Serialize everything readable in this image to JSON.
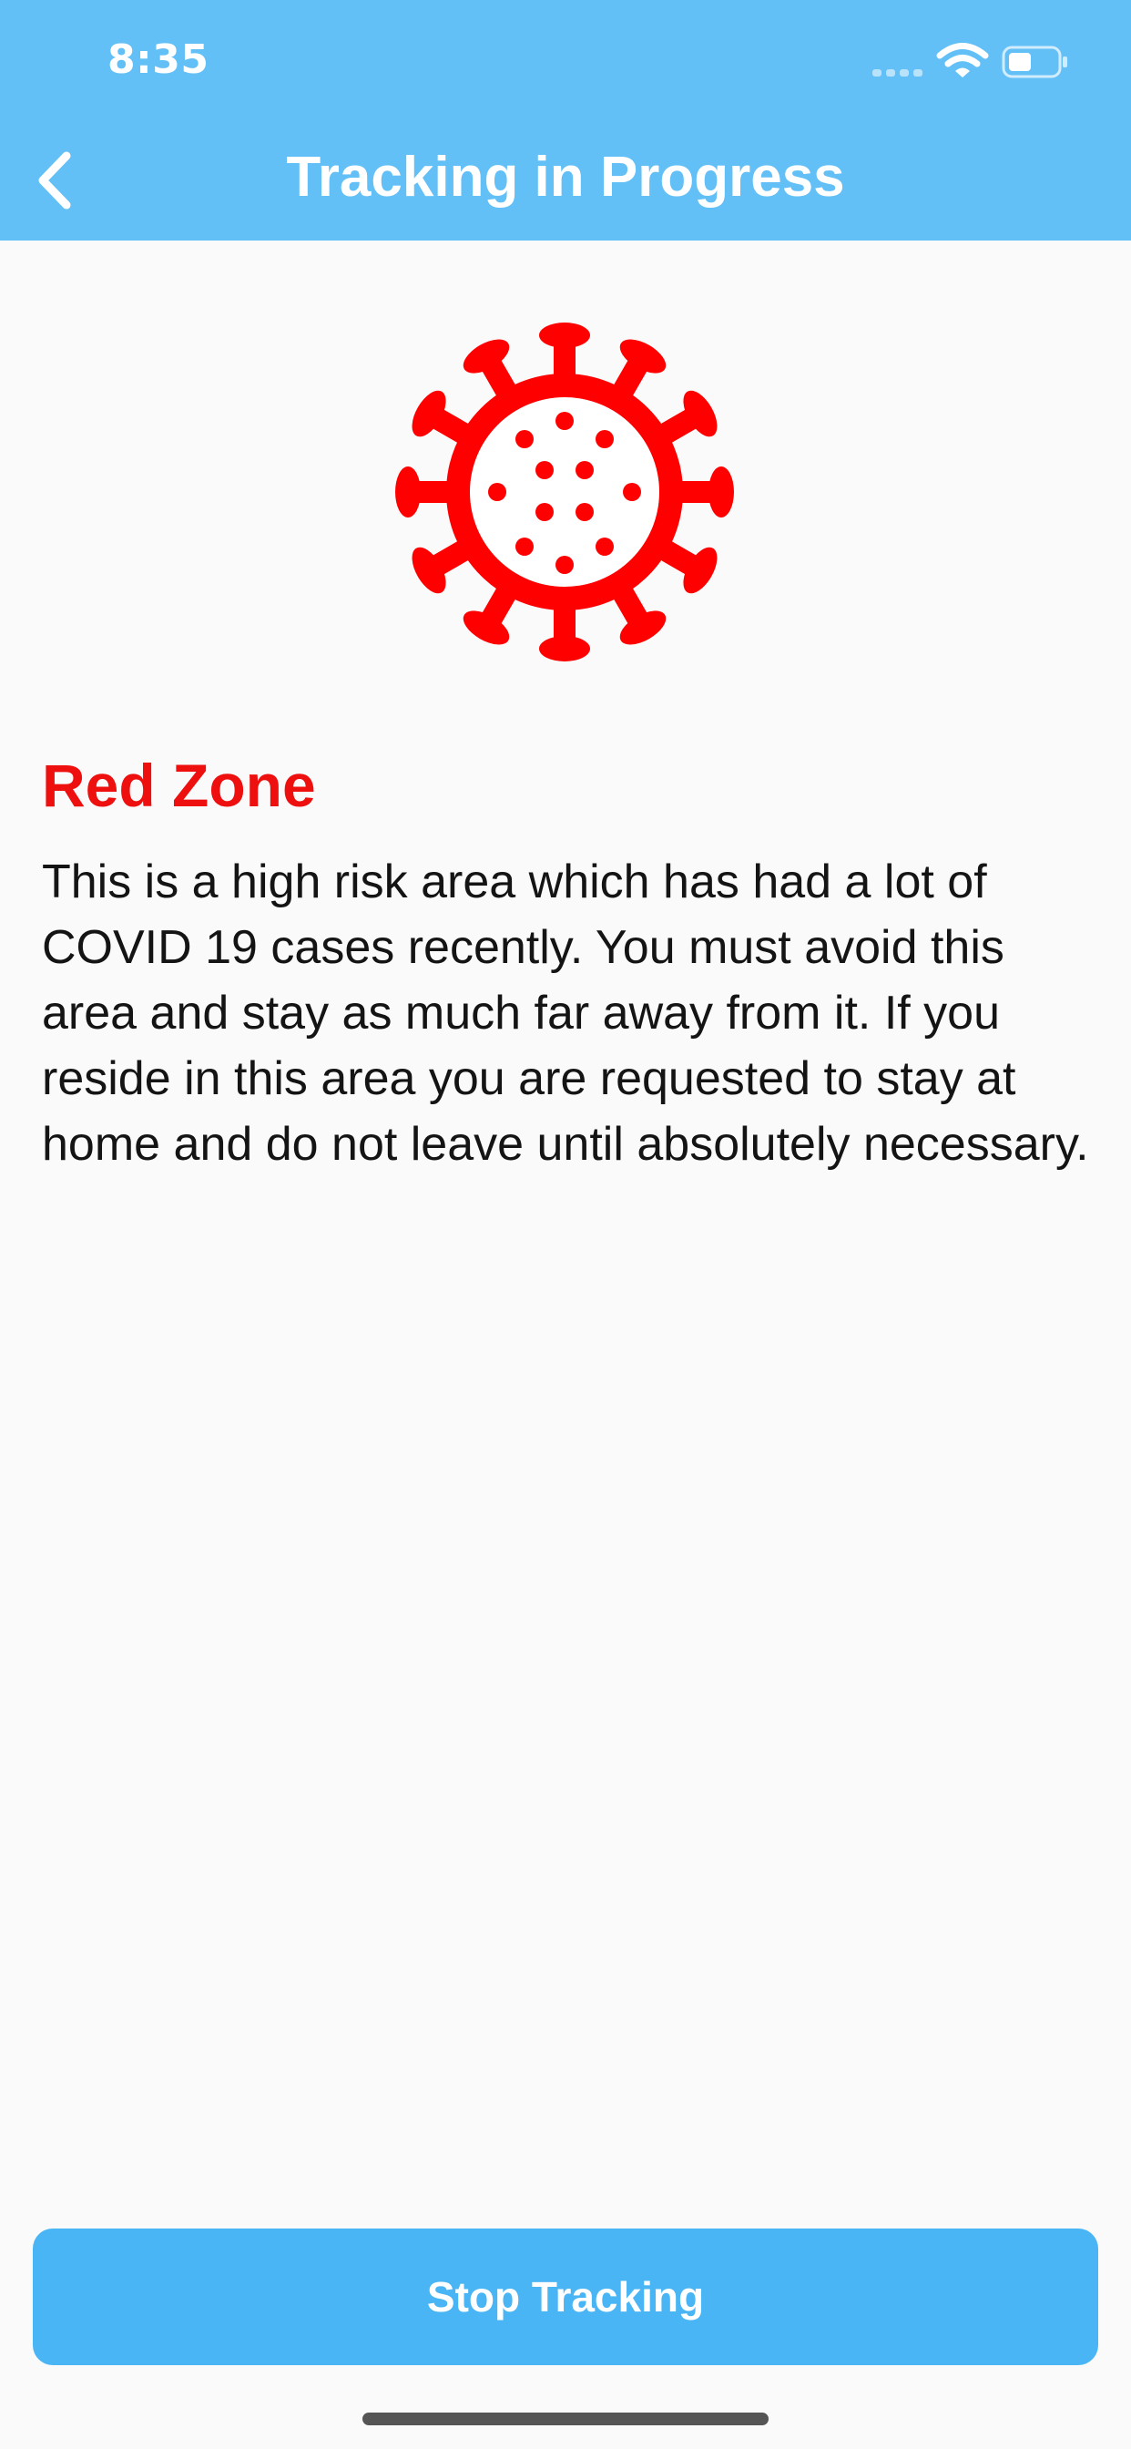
{
  "status_bar": {
    "time": "8:35"
  },
  "nav": {
    "title": "Tracking in Progress",
    "back_icon": "chevron-left-icon"
  },
  "hero_icon": "virus-icon",
  "zone": {
    "title": "Red Zone",
    "description": "This is a high risk area which has had a lot of COVID 19 cases recently. You must avoid this area and stay as much far away from it. If you reside in this area you are requested to stay at home and do not leave until absolutely necessary."
  },
  "actions": {
    "stop_label": "Stop Tracking"
  },
  "colors": {
    "header": "#62c0f7",
    "button": "#49b5f4",
    "zone_red": "#ee0f0f",
    "icon_red": "#ff0000",
    "background": "#fafafa"
  }
}
